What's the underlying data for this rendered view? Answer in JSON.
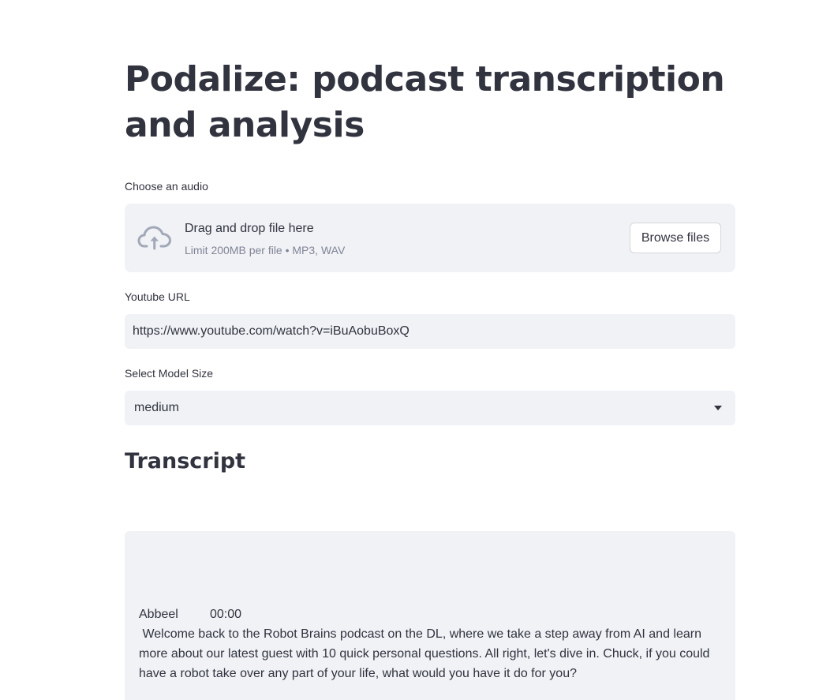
{
  "page": {
    "title": "Podalize: podcast transcription and analysis"
  },
  "uploader": {
    "label": "Choose an audio",
    "drop_text": "Drag and drop file here",
    "hint": "Limit 200MB per file • MP3, WAV",
    "browse_label": "Browse files",
    "icon": "cloud-upload-icon"
  },
  "youtube": {
    "label": "Youtube URL",
    "value": "https://www.youtube.com/watch?v=iBuAobuBoxQ"
  },
  "model_size": {
    "label": "Select Model Size",
    "selected": "medium",
    "icon": "caret-down-icon"
  },
  "transcript": {
    "heading": "Transcript",
    "entries": [
      {
        "speaker": "Abbeel",
        "time": "00:00",
        "text": " Welcome back to the Robot Brains podcast on the DL, where we take a step away from AI and learn more about our latest guest with 10 quick personal questions. All right, let's dive in. Chuck, if you could have a robot take over any part of your life, what would you have it do for you?"
      }
    ]
  },
  "colors": {
    "background": "#ffffff",
    "widget_background": "#f0f2f6",
    "text": "#31333f",
    "muted_text": "#808495",
    "icon": "#a3a8b8"
  }
}
